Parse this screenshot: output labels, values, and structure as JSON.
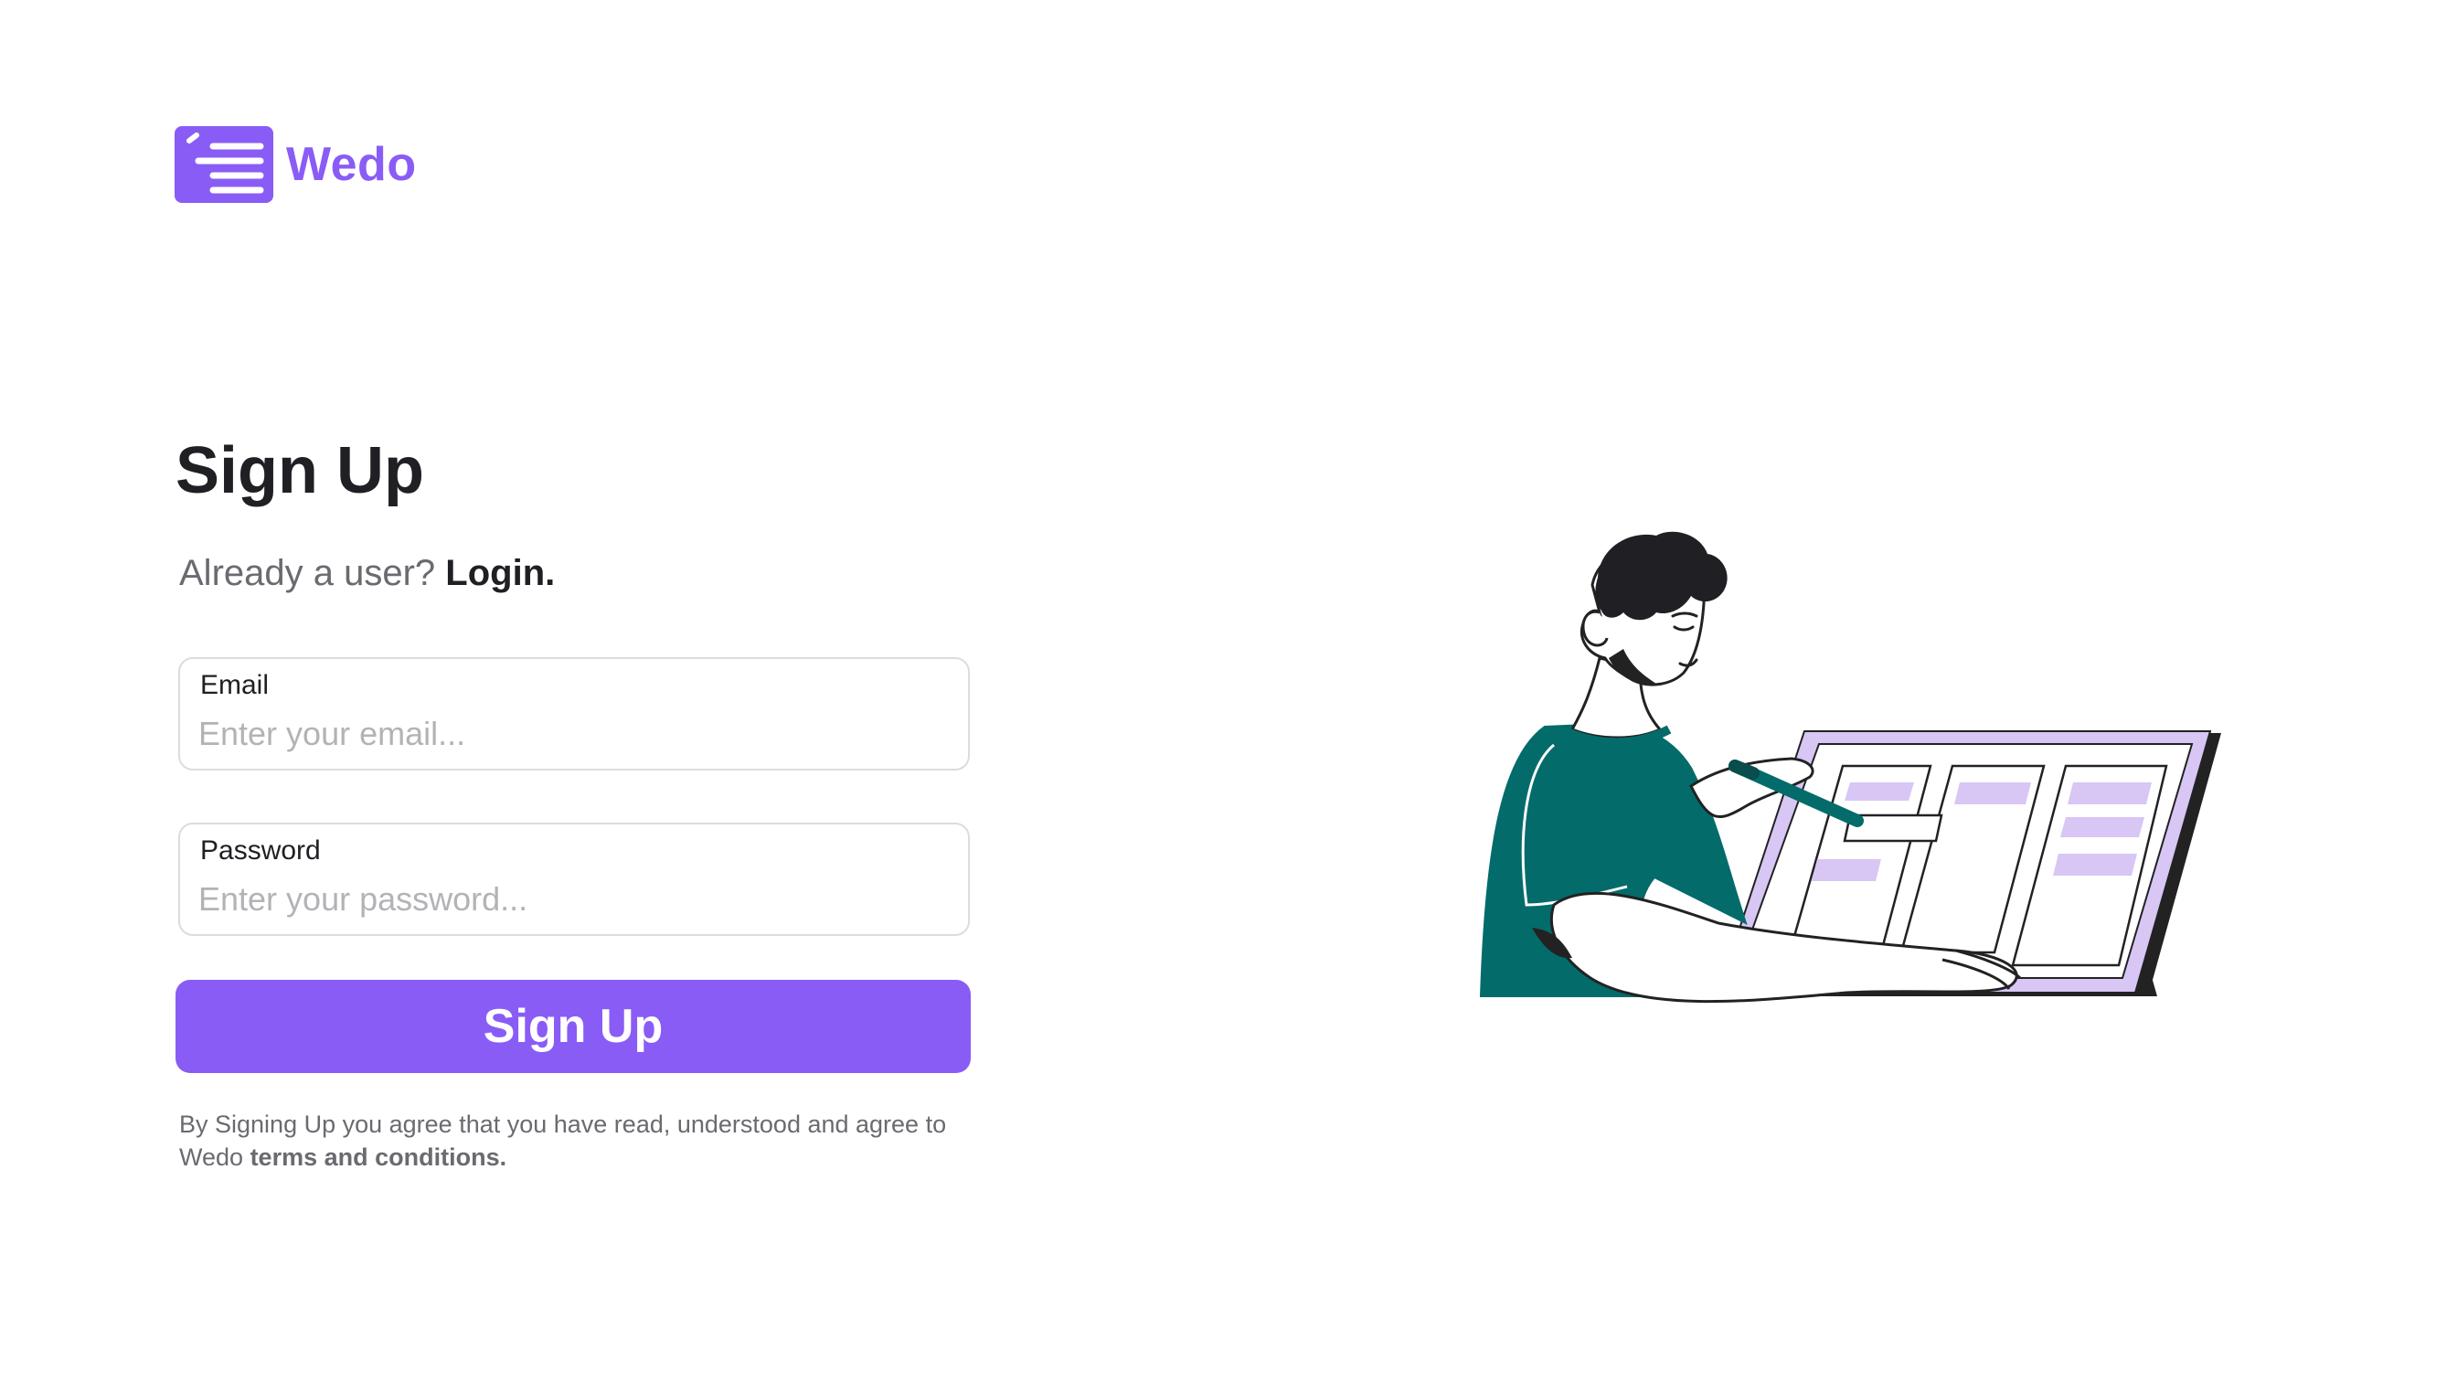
{
  "brand": {
    "name": "Wedo",
    "logo_icon": "checklist-icon",
    "color": "#8a5cf6"
  },
  "form": {
    "title": "Sign Up",
    "subtitle_text": "Already a user?",
    "login_link": "Login.",
    "email": {
      "label": "Email",
      "placeholder": "Enter your email...",
      "value": ""
    },
    "password": {
      "label": "Password",
      "placeholder": "Enter your password...",
      "value": ""
    },
    "submit_label": "Sign Up",
    "terms_text": "By Signing Up you agree that you have read, understood and agree to Wedo",
    "terms_link": "terms and conditions."
  },
  "colors": {
    "accent": "#8a5cf6",
    "text_dark": "#1f1f24",
    "text_muted": "#6a6a70",
    "shirt": "#046b6b",
    "board_light": "#d8c6f5"
  }
}
